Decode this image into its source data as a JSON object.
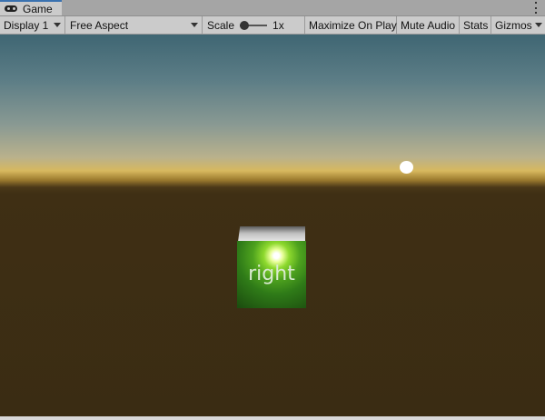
{
  "tab": {
    "title": "Game",
    "icon": "gamepad-icon"
  },
  "toolbar": {
    "display": "Display 1",
    "aspect": "Free Aspect",
    "scale_label": "Scale",
    "scale_value": "1x",
    "maximize": "Maximize On Play",
    "mute": "Mute Audio",
    "stats": "Stats",
    "gizmos": "Gizmos"
  },
  "scene": {
    "cube_label": "right",
    "colors": {
      "cube": "#4ea21e",
      "sky_top": "#3f6673",
      "horizon": "#d7b85e",
      "ground": "#3a2c13",
      "sun": "#ffffff"
    }
  }
}
